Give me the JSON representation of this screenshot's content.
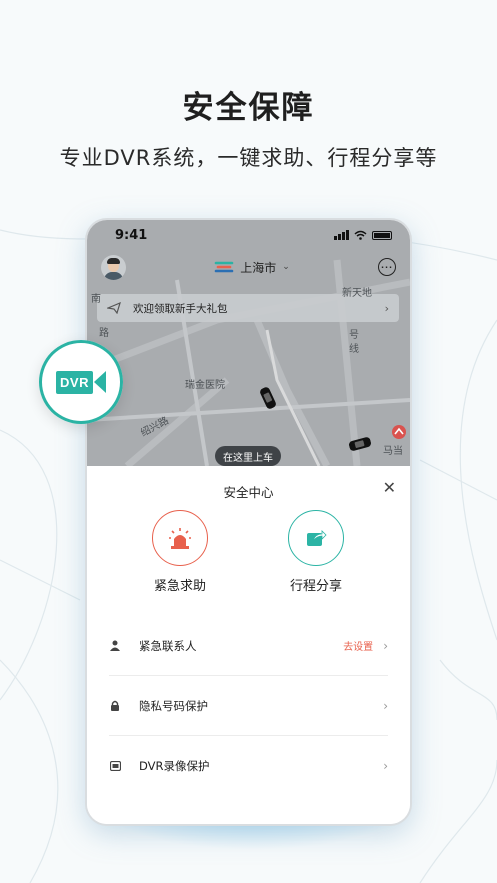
{
  "headline": "安全保障",
  "subline": "专业DVR系统，一键求助、行程分享等",
  "phone": {
    "status": {
      "time": "9:41"
    },
    "topbar": {
      "city": "上海市"
    },
    "promo": {
      "text": "欢迎领取新手大礼包"
    },
    "map_labels": {
      "hospital": "瑞金医院",
      "road_shaoxing": "绍兴路",
      "road_lu": "路",
      "road_nan": "南",
      "xintiandi": "新天地",
      "madang": "马当",
      "xianzi": "线",
      "eastside": "号"
    },
    "pickup": "在这里上车",
    "sheet": {
      "title": "安全中心",
      "actions": [
        {
          "label": "紧急求助",
          "color": "#e8614d"
        },
        {
          "label": "行程分享",
          "color": "#2cb4a5"
        }
      ],
      "rows": [
        {
          "label": "紧急联系人",
          "extra": "去设置",
          "icon": "person-icon"
        },
        {
          "label": "隐私号码保护",
          "extra": "",
          "icon": "lock-icon"
        },
        {
          "label": "DVR录像保护",
          "extra": "",
          "icon": "video-icon"
        }
      ]
    }
  },
  "badge": {
    "text": "DVR"
  },
  "colors": {
    "accent_teal": "#2bb3a4",
    "accent_red": "#e8614d"
  }
}
